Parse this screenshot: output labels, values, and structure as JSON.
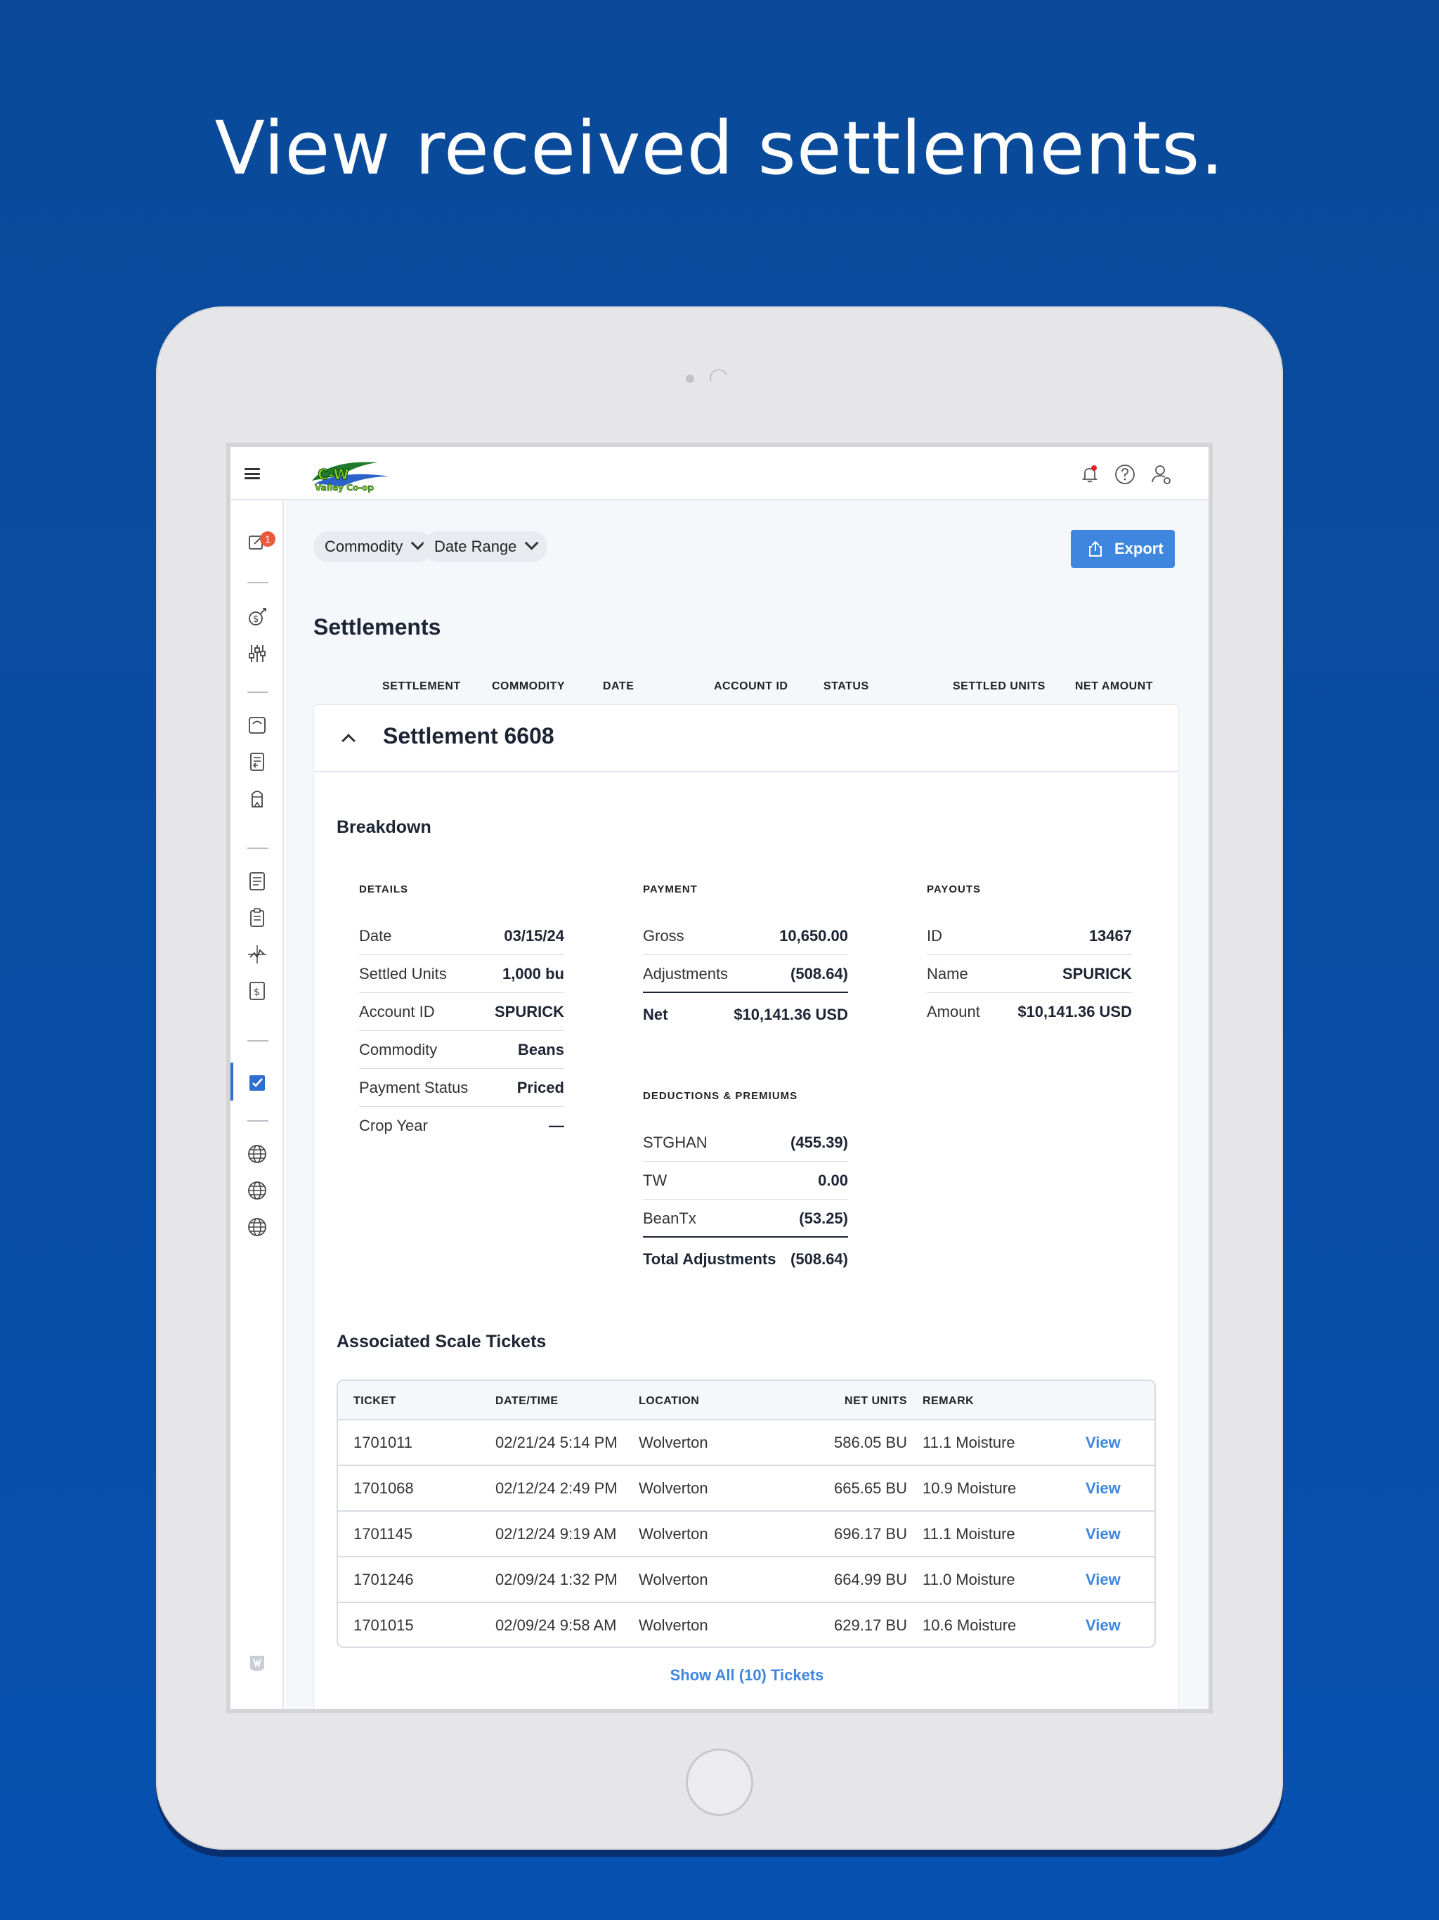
{
  "headline": "View received settlements.",
  "notifications_badge": "1",
  "filters": {
    "commodity": "Commodity",
    "date_range": "Date Range"
  },
  "export_label": "Export",
  "page_title": "Settlements",
  "columns": [
    "SETTLEMENT",
    "COMMODITY",
    "DATE",
    "ACCOUNT ID",
    "STATUS",
    "SETTLED UNITS",
    "NET AMOUNT"
  ],
  "settlement": {
    "title": "Settlement 6608",
    "breakdown_title": "Breakdown",
    "details": {
      "label": "DETAILS",
      "rows": [
        {
          "k": "Date",
          "v": "03/15/24"
        },
        {
          "k": "Settled Units",
          "v": "1,000 bu"
        },
        {
          "k": "Account ID",
          "v": "SPURICK"
        },
        {
          "k": "Commodity",
          "v": "Beans"
        },
        {
          "k": "Payment Status",
          "v": "Priced"
        },
        {
          "k": "Crop Year",
          "v": "—"
        }
      ]
    },
    "payment": {
      "label": "PAYMENT",
      "rows": [
        {
          "k": "Gross",
          "v": "10,650.00"
        },
        {
          "k": "Adjustments",
          "v": "(508.64)"
        },
        {
          "k": "Net",
          "v": "$10,141.36 USD"
        }
      ]
    },
    "deductions": {
      "label": "DEDUCTIONS & PREMIUMS",
      "rows": [
        {
          "k": "STGHAN",
          "v": "(455.39)"
        },
        {
          "k": "TW",
          "v": "0.00"
        },
        {
          "k": "BeanTx",
          "v": "(53.25)"
        },
        {
          "k": "Total Adjustments",
          "v": "(508.64)"
        }
      ]
    },
    "payouts": {
      "label": "PAYOUTS",
      "rows": [
        {
          "k": "ID",
          "v": "13467"
        },
        {
          "k": "Name",
          "v": "SPURICK"
        },
        {
          "k": "Amount",
          "v": "$10,141.36 USD"
        }
      ]
    },
    "tickets": {
      "title": "Associated Scale Tickets",
      "headers": [
        "TICKET",
        "DATE/TIME",
        "LOCATION",
        "NET UNITS",
        "REMARK"
      ],
      "view_label": "View",
      "rows": [
        {
          "ticket": "1701011",
          "datetime": "02/21/24 5:14 PM",
          "location": "Wolverton",
          "net_units": "586.05 BU",
          "remark": "11.1 Moisture"
        },
        {
          "ticket": "1701068",
          "datetime": "02/12/24 2:49 PM",
          "location": "Wolverton",
          "net_units": "665.65 BU",
          "remark": "10.9 Moisture"
        },
        {
          "ticket": "1701145",
          "datetime": "02/12/24 9:19 AM",
          "location": "Wolverton",
          "net_units": "696.17 BU",
          "remark": "11.1 Moisture"
        },
        {
          "ticket": "1701246",
          "datetime": "02/09/24 1:32 PM",
          "location": "Wolverton",
          "net_units": "664.99 BU",
          "remark": "11.0 Moisture"
        },
        {
          "ticket": "1701015",
          "datetime": "02/09/24 9:58 AM",
          "location": "Wolverton",
          "net_units": "629.17 BU",
          "remark": "10.6 Moisture"
        }
      ],
      "show_all": "Show All (10) Tickets"
    }
  },
  "colors": {
    "background": "#0a4a99",
    "accent": "#3f86df",
    "badge": "#e85a3c"
  },
  "icons": {
    "top": [
      "bell-icon",
      "help-icon",
      "user-settings-icon"
    ],
    "sidebar": [
      "tasks-icon",
      "money-target-icon",
      "sliders-icon",
      "scale-icon",
      "ticket-transfer-icon",
      "silo-icon",
      "receipt-icon",
      "clipboard-icon",
      "trend-icon",
      "payment-icon",
      "settlements-icon",
      "globe-icon",
      "globe-icon",
      "globe-icon",
      "brand-shield-icon"
    ]
  }
}
